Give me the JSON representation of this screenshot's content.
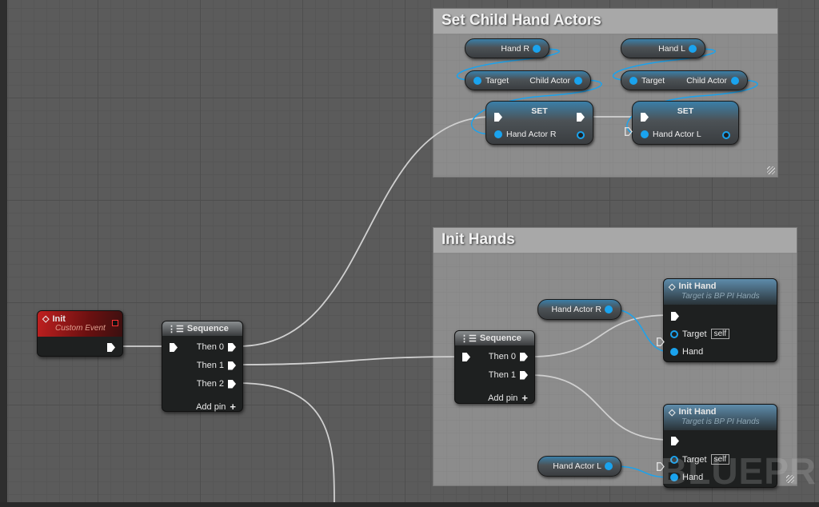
{
  "comments": [
    {
      "title": "Set Child Hand Actors"
    },
    {
      "title": "Init Hands"
    }
  ],
  "init_event": {
    "title": "Init",
    "subtitle": "Custom Event",
    "icon": "event-diamond-icon"
  },
  "sequence1": {
    "title": "Sequence",
    "outputs": [
      "Then 0",
      "Then 1",
      "Then 2"
    ],
    "add_pin": "Add pin"
  },
  "sequence2": {
    "title": "Sequence",
    "outputs": [
      "Then 0",
      "Then 1"
    ],
    "add_pin": "Add pin"
  },
  "set_child": {
    "hand_r": "Hand R",
    "hand_l": "Hand L",
    "getter_target": "Target",
    "getter_child": "Child Actor",
    "set_label": "SET",
    "set_r_var": "Hand Actor R",
    "set_l_var": "Hand Actor L"
  },
  "init_hands": {
    "var_r": "Hand Actor R",
    "var_l": "Hand Actor L",
    "node_title": "Init Hand",
    "node_subtitle": "Target is BP PI Hands",
    "target": "Target",
    "self": "self",
    "hand": "Hand"
  },
  "watermark": "BLUEPRINT",
  "colors": {
    "exec_wire": "#d0d0d0",
    "data_wire": "#1aa3ee",
    "event_header": "#b01818",
    "function_header": "#3f6e8e"
  }
}
